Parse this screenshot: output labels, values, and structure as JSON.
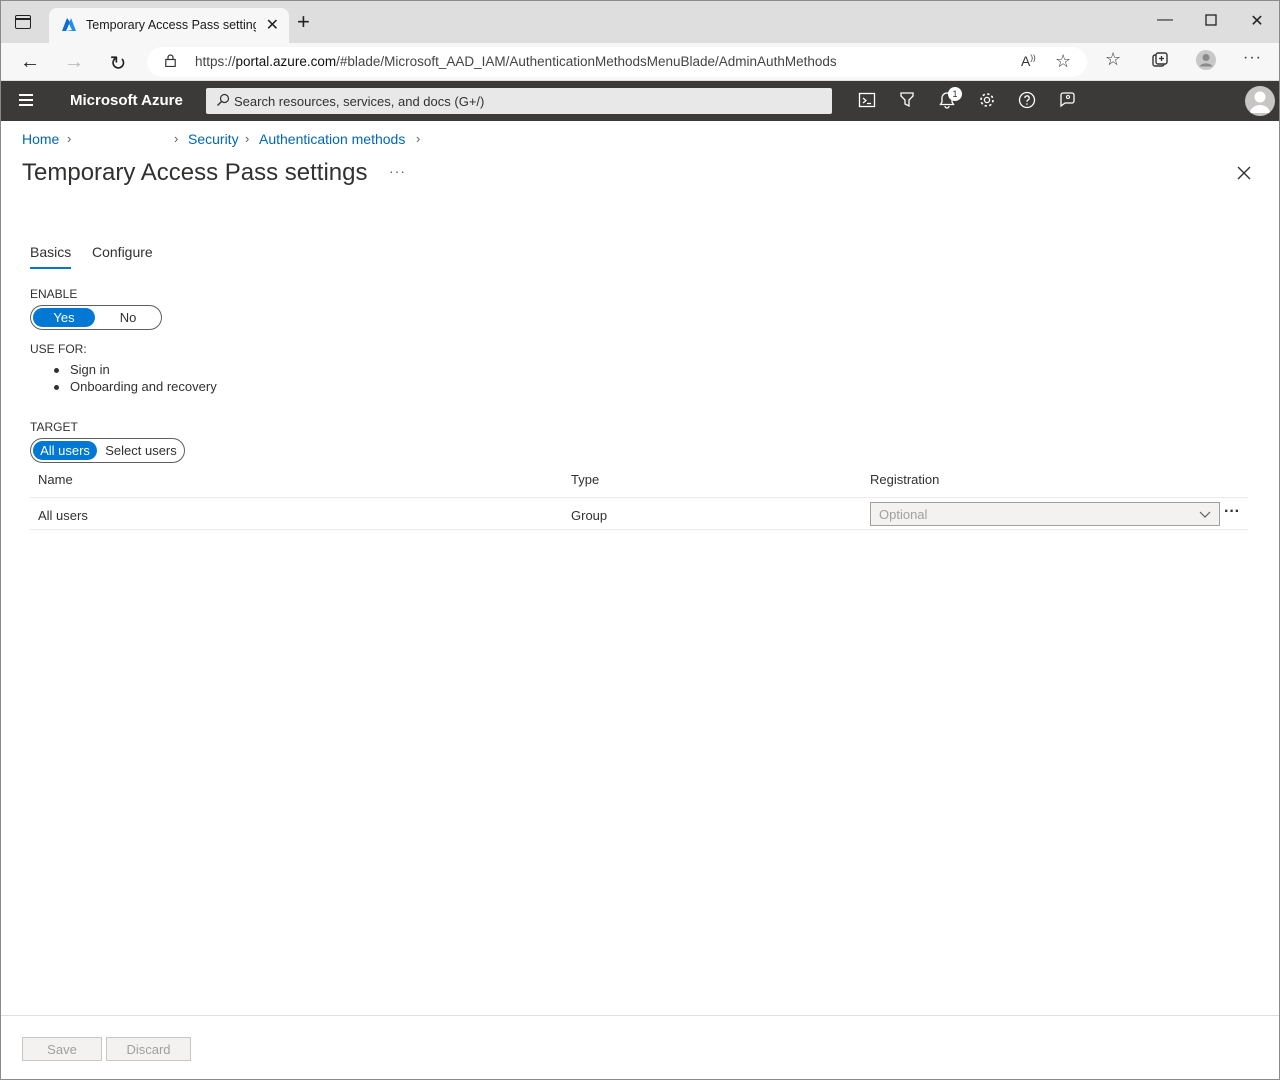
{
  "browser": {
    "tab_title": "Temporary Access Pass settings - Microsoft Azure",
    "url_prefix": "https://",
    "url_host": "portal.azure.com",
    "url_path": "/#blade/Microsoft_AAD_IAM/AuthenticationMethodsMenuBlade/AdminAuthMethods"
  },
  "azure": {
    "brand": "Microsoft Azure",
    "search_placeholder": "Search resources, services, and docs (G+/)",
    "notification_count": "1"
  },
  "breadcrumb": {
    "home": "Home",
    "security": "Security",
    "auth_methods": "Authentication methods"
  },
  "page": {
    "title": "Temporary Access Pass settings",
    "more": "···"
  },
  "tabs": [
    {
      "label": "Basics",
      "active": true
    },
    {
      "label": "Configure",
      "active": false
    }
  ],
  "enable": {
    "label": "ENABLE",
    "yes": "Yes",
    "no": "No",
    "selected": "Yes"
  },
  "use_for": {
    "label": "USE FOR:",
    "items": [
      "Sign in",
      "Onboarding and recovery"
    ]
  },
  "target": {
    "label": "TARGET",
    "all_users": "All users",
    "select_users": "Select users",
    "selected": "All users"
  },
  "grid": {
    "columns": [
      "Name",
      "Type",
      "Registration"
    ],
    "rows": [
      {
        "name": "All users",
        "type": "Group",
        "registration": "Optional"
      }
    ]
  },
  "footer": {
    "save": "Save",
    "discard": "Discard"
  },
  "colors": {
    "accent": "#0078d4",
    "link": "#0067b8",
    "header_bg": "#3b3a39"
  }
}
